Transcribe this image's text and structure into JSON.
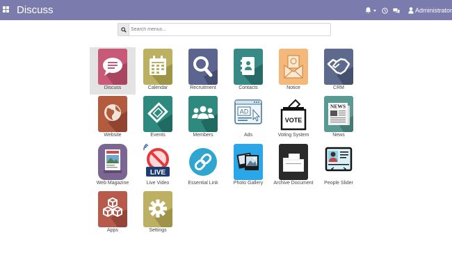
{
  "header": {
    "app_title": "Discuss",
    "user_name": "Administrator",
    "icons": [
      "apps-grid-icon",
      "bell-icon",
      "clock-icon",
      "chat-icon",
      "user-icon"
    ]
  },
  "search": {
    "placeholder": "Search menus..."
  },
  "apps": [
    {
      "label": "Discuss",
      "icon": "chat-bubble-icon",
      "active": true
    },
    {
      "label": "Calendar",
      "icon": "calendar-icon"
    },
    {
      "label": "Recruitment",
      "icon": "magnifier-icon"
    },
    {
      "label": "Contacts",
      "icon": "address-book-icon"
    },
    {
      "label": "Notice",
      "icon": "envelope-icon"
    },
    {
      "label": "CRM",
      "icon": "handshake-icon"
    },
    {
      "label": "Website",
      "icon": "globe-icon"
    },
    {
      "label": "Events",
      "icon": "ticket-icon"
    },
    {
      "label": "Members",
      "icon": "members-icon"
    },
    {
      "label": "Ads",
      "icon": "ad-browser-icon",
      "ad_text": "AD"
    },
    {
      "label": "Voting System",
      "icon": "ballot-box-icon",
      "vote_text": "VOTE"
    },
    {
      "label": "News",
      "icon": "newspaper-icon",
      "news_text": "NEWS"
    },
    {
      "label": "Web Magazine",
      "icon": "magazine-icon"
    },
    {
      "label": "Live Video",
      "icon": "live-video-icon",
      "live_text": "LIVE"
    },
    {
      "label": "Essential Link",
      "icon": "link-icon"
    },
    {
      "label": "Photo Gallery",
      "icon": "photo-gallery-icon"
    },
    {
      "label": "Archive Document",
      "icon": "folder-icon"
    },
    {
      "label": "People Slider",
      "icon": "people-slider-icon"
    },
    {
      "label": "Apps",
      "icon": "cubes-icon"
    },
    {
      "label": "Settings",
      "icon": "gear-icon"
    }
  ],
  "colors": {
    "navbar": "#7c7bad",
    "discuss": "#c85a78",
    "calendar": "#bcb163",
    "recruitment": "#5c6590",
    "contacts": "#388a86",
    "notice": "#f4b97a",
    "crm": "#5d6a8c",
    "website": "#b25b3f",
    "events": "#2e8a7e",
    "members": "#2e8a7e",
    "essential_link": "#2fa6cf",
    "apps": "#b75a4c",
    "settings": "#bdb062"
  }
}
